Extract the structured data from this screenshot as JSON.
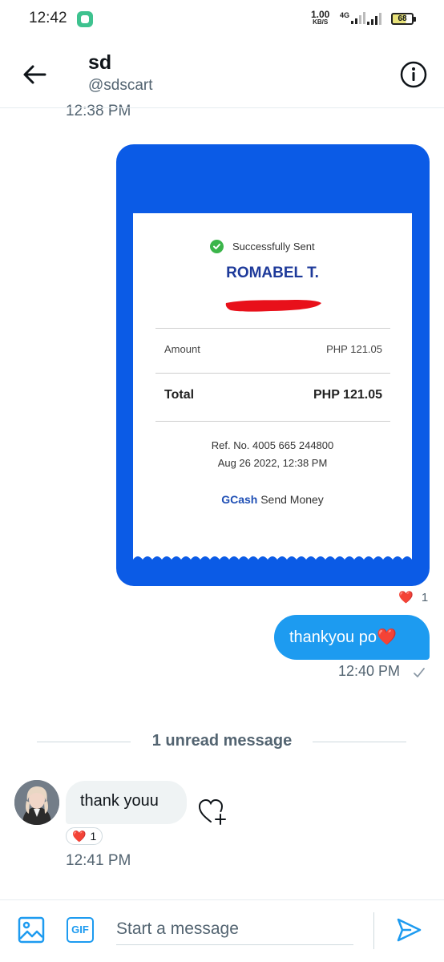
{
  "status_bar": {
    "time": "12:42",
    "speed_value": "1.00",
    "speed_unit": "KB/S",
    "network": "4G",
    "battery": "68"
  },
  "header": {
    "name": "sd",
    "handle": "@sdscart"
  },
  "previous_time": "12:38 PM",
  "receipt": {
    "status": "Successfully Sent",
    "recipient": "ROMABEL T.",
    "amount_label": "Amount",
    "amount_value": "PHP 121.05",
    "total_label": "Total",
    "total_value": "PHP 121.05",
    "ref_no": "Ref. No. 4005 665 244800",
    "date": "Aug 26 2022, 12:38 PM",
    "brand": "GCash",
    "service": "Send Money",
    "reaction_emoji": "❤️",
    "reaction_count": "1",
    "colors": {
      "card": "#0b5be6",
      "recipient": "#1e3a9a",
      "redaction": "#e8101a"
    }
  },
  "sent_message": {
    "text": "thankyou po❤️",
    "time": "12:40 PM",
    "bubble_color": "#1d9bf0"
  },
  "unread_divider": "1 unread message",
  "received_message": {
    "text": "thank youu",
    "reaction_emoji": "❤️",
    "reaction_count": "1",
    "time": "12:41 PM"
  },
  "composer": {
    "placeholder": "Start a message",
    "gif_label": "GIF"
  },
  "icons": [
    "back-arrow-icon",
    "info-icon",
    "check-circle-icon",
    "heart-plus-icon",
    "image-icon",
    "gif-icon",
    "send-icon"
  ],
  "accent": "#1d9bf0"
}
